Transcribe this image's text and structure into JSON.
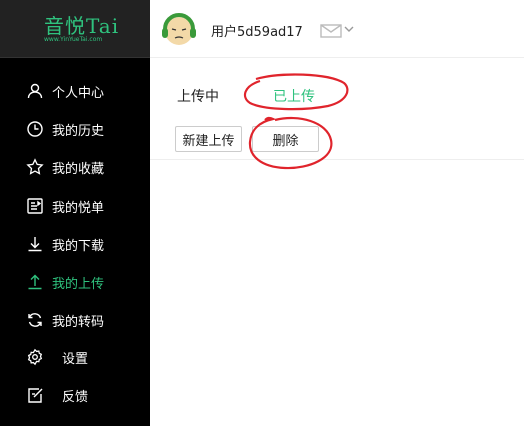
{
  "app": {
    "logo_text": "音悦Tai",
    "logo_subtext": "www.YinYueTai.com"
  },
  "header": {
    "username": "用户5d59ad17"
  },
  "sidebar": {
    "items": [
      {
        "label": "个人中心",
        "icon": "user-icon",
        "active": false
      },
      {
        "label": "我的历史",
        "icon": "clock-icon",
        "active": false
      },
      {
        "label": "我的收藏",
        "icon": "star-icon",
        "active": false
      },
      {
        "label": "我的悦单",
        "icon": "playlist-icon",
        "active": false
      },
      {
        "label": "我的下载",
        "icon": "download-icon",
        "active": false
      },
      {
        "label": "我的上传",
        "icon": "upload-icon",
        "active": true
      },
      {
        "label": "我的转码",
        "icon": "transcode-icon",
        "active": false
      },
      {
        "label": "设置",
        "icon": "gear-icon",
        "active": false
      },
      {
        "label": "反馈",
        "icon": "feedback-icon",
        "active": false
      }
    ]
  },
  "main": {
    "tabs": [
      {
        "label": "上传中",
        "active": false
      },
      {
        "label": "已上传",
        "active": true
      }
    ],
    "buttons": {
      "new_upload": "新建上传",
      "delete": "删除"
    }
  },
  "colors": {
    "accent": "#2fc27e",
    "sidebar_bg": "#000000",
    "annotation": "#e0242c"
  }
}
